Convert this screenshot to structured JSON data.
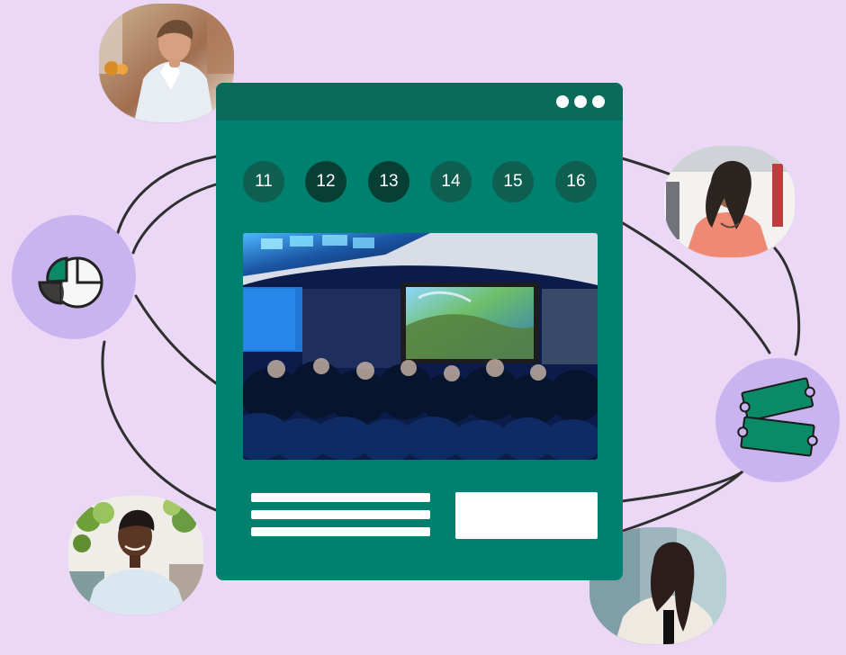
{
  "event_card": {
    "window_controls": [
      "dot",
      "dot",
      "dot"
    ],
    "dates": [
      {
        "label": "11",
        "active": false
      },
      {
        "label": "12",
        "active": true
      },
      {
        "label": "13",
        "active": true
      },
      {
        "label": "14",
        "active": false
      },
      {
        "label": "15",
        "active": false
      },
      {
        "label": "16",
        "active": false
      }
    ],
    "hero_image": {
      "subject": "conference audience watching a large projected game screen"
    },
    "text_placeholder_lines": 3,
    "button_placeholder": "blank white button"
  },
  "icons": {
    "chart": "pie-chart-icon",
    "tickets": "tickets-icon"
  },
  "people": [
    {
      "name": "avatar-top-left"
    },
    {
      "name": "avatar-right-top"
    },
    {
      "name": "avatar-bottom-left"
    },
    {
      "name": "avatar-bottom-right"
    }
  ],
  "colors": {
    "background": "#ead8f6",
    "card": "#00806f",
    "card_bar": "#0b6a59",
    "date_pill": "#0f5f50",
    "date_pill_active": "#073f35",
    "badge": "#c9b4ef",
    "accent_green": "#0b8a67"
  }
}
